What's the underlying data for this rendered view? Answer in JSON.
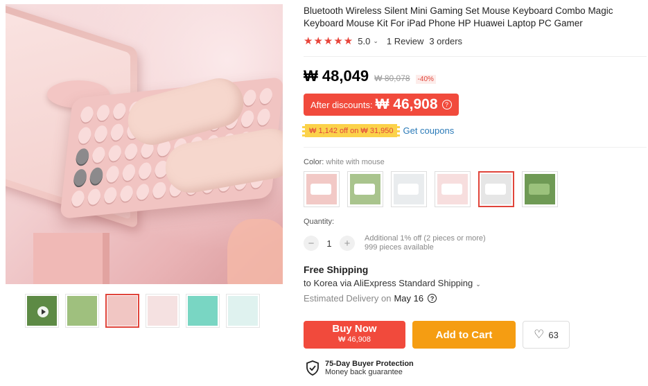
{
  "product": {
    "title": "Bluetooth Wireless Silent Mini Gaming Set Mouse Keyboard Combo Magic Keyboard Mouse Kit For iPad Phone HP Huawei Laptop PC Gamer",
    "rating": {
      "stars": "★★★★★",
      "score": "5.0",
      "reviews": "1 Review",
      "orders": "3 orders"
    }
  },
  "price": {
    "current": "₩ 48,049",
    "original": "₩ 80,078",
    "discount": "-40%"
  },
  "after_discount": {
    "label": "After discounts:",
    "amount": "₩ 46,908",
    "help": "?"
  },
  "coupon": {
    "tag": "₩ 1,142 off on ₩ 31,950",
    "link": "Get coupons"
  },
  "color": {
    "label": "Color:",
    "selected": "white with mouse",
    "swatch_colors": [
      "#f2c9c6",
      "#a9c48d",
      "#e9ecee",
      "#f7dede",
      "#e6e6e6",
      "#6f9a55"
    ],
    "selected_index": 4
  },
  "quantity": {
    "label": "Quantity:",
    "minus": "−",
    "value": "1",
    "plus": "+",
    "note_line1": "Additional 1% off (2 pieces or more)",
    "note_line2": "999 pieces available"
  },
  "shipping": {
    "title": "Free Shipping",
    "to": "to Korea via AliExpress Standard Shipping",
    "est_prefix": "Estimated Delivery on",
    "est_date": "May 16"
  },
  "actions": {
    "buy_label": "Buy Now",
    "buy_price": "₩ 46,908",
    "cart_label": "Add to Cart",
    "wish_count": "63"
  },
  "protection": {
    "title": "75-Day Buyer Protection",
    "subtitle": "Money back guarantee"
  },
  "gallery": {
    "thumb_colors": [
      "#5d8a45",
      "#9fc07e",
      "#f1c6c3",
      "#f5e1e1",
      "#79d6c3",
      "#dff2ef"
    ],
    "active_thumb": 2
  }
}
